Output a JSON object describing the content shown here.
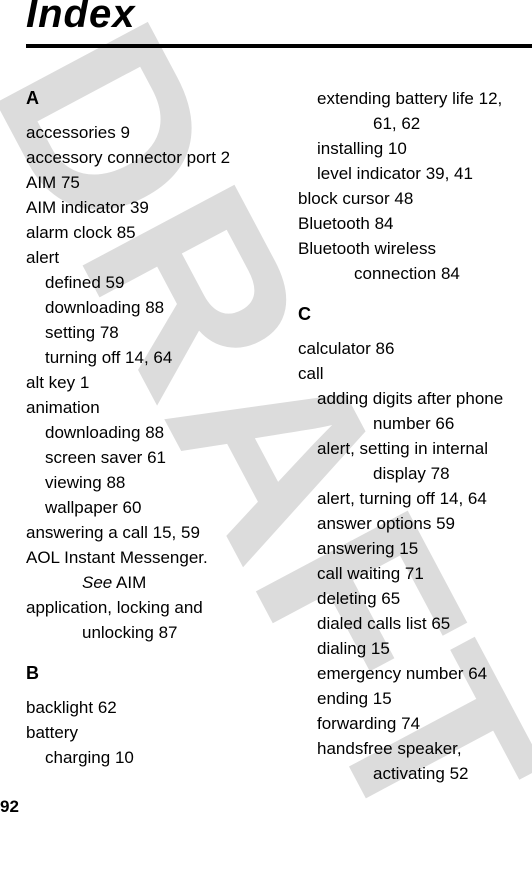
{
  "watermark": "DRAFT",
  "title": "Index",
  "page_number": "92",
  "left_column": {
    "sections": [
      {
        "letter": "A",
        "entries": [
          {
            "text": "accessories",
            "pages": "9",
            "level": 1
          },
          {
            "text": "accessory connector port",
            "pages": "2",
            "level": 1
          },
          {
            "text": "AIM",
            "pages": "75",
            "level": 1
          },
          {
            "text": "AIM indicator",
            "pages": "39",
            "level": 1
          },
          {
            "text": "alarm clock",
            "pages": "85",
            "level": 1
          },
          {
            "text": "alert",
            "pages": "",
            "level": 1
          },
          {
            "text": "defined",
            "pages": "59",
            "level": 2
          },
          {
            "text": "downloading",
            "pages": "88",
            "level": 2
          },
          {
            "text": "setting",
            "pages": "78",
            "level": 2
          },
          {
            "text": "turning off",
            "pages": "14, 64",
            "level": 2
          },
          {
            "text": "alt key",
            "pages": "1",
            "level": 1
          },
          {
            "text": "animation",
            "pages": "",
            "level": 1
          },
          {
            "text": "downloading",
            "pages": "88",
            "level": 2
          },
          {
            "text": "screen saver",
            "pages": "61",
            "level": 2
          },
          {
            "text": "viewing",
            "pages": "88",
            "level": 2
          },
          {
            "text": "wallpaper",
            "pages": "60",
            "level": 2
          },
          {
            "text": "answering a call",
            "pages": "15, 59",
            "level": 1
          },
          {
            "text": "AOL Instant Messenger.",
            "see_label": "See",
            "see_target": "AIM",
            "level": 1
          },
          {
            "text": "application, locking and",
            "continuation": "unlocking",
            "pages": "87",
            "level": 1
          }
        ]
      },
      {
        "letter": "B",
        "entries": [
          {
            "text": "backlight",
            "pages": "62",
            "level": 1
          },
          {
            "text": "battery",
            "pages": "",
            "level": 1
          },
          {
            "text": "charging",
            "pages": "10",
            "level": 2
          }
        ]
      }
    ]
  },
  "right_column": {
    "sections": [
      {
        "letter": "",
        "entries": [
          {
            "text": "extending battery life",
            "pages": "12,",
            "continuation": "61, 62",
            "level": 2
          },
          {
            "text": "installing",
            "pages": "10",
            "level": 2
          },
          {
            "text": "level indicator",
            "pages": "39, 41",
            "level": 2
          },
          {
            "text": "block cursor",
            "pages": "48",
            "level": 1
          },
          {
            "text": "Bluetooth",
            "pages": "84",
            "level": 1
          },
          {
            "text": "Bluetooth wireless",
            "continuation": "connection",
            "pages": "84",
            "level": 1
          }
        ]
      },
      {
        "letter": "C",
        "entries": [
          {
            "text": "calculator",
            "pages": "86",
            "level": 1
          },
          {
            "text": "call",
            "pages": "",
            "level": 1
          },
          {
            "text": "adding digits after phone",
            "continuation": "number",
            "pages": "66",
            "level": 2
          },
          {
            "text": "alert, setting in internal",
            "continuation": "display",
            "pages": "78",
            "level": 2
          },
          {
            "text": "alert, turning off",
            "pages": "14, 64",
            "level": 2
          },
          {
            "text": "answer options",
            "pages": "59",
            "level": 2
          },
          {
            "text": "answering",
            "pages": "15",
            "level": 2
          },
          {
            "text": "call waiting",
            "pages": "71",
            "level": 2
          },
          {
            "text": "deleting",
            "pages": "65",
            "level": 2
          },
          {
            "text": "dialed calls list",
            "pages": "65",
            "level": 2
          },
          {
            "text": "dialing",
            "pages": "15",
            "level": 2
          },
          {
            "text": "emergency number",
            "pages": "64",
            "level": 2
          },
          {
            "text": "ending",
            "pages": "15",
            "level": 2
          },
          {
            "text": "forwarding",
            "pages": "74",
            "level": 2
          },
          {
            "text": "handsfree speaker,",
            "continuation": "activating",
            "pages": "52",
            "level": 2
          }
        ]
      }
    ]
  }
}
